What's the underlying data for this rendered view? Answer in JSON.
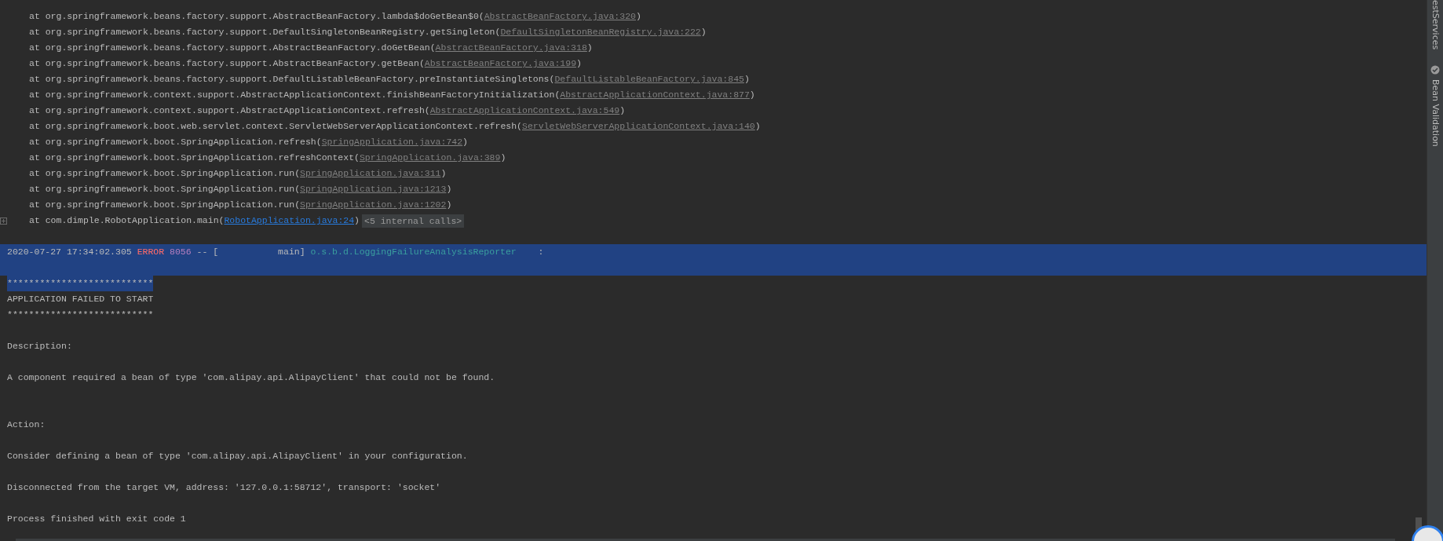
{
  "console": {
    "lines": [
      {
        "kind": "frame",
        "text": "at org.springframework.beans.factory.support.AbstractBeanFactory.lambda$doGetBean$0(",
        "link": "AbstractBeanFactory.java:320",
        "tail": ")",
        "selected": false
      },
      {
        "kind": "frame",
        "text": "at org.springframework.beans.factory.support.DefaultSingletonBeanRegistry.getSingleton(",
        "link": "DefaultSingletonBeanRegistry.java:222",
        "tail": ")",
        "selected": false
      },
      {
        "kind": "frame",
        "text": "at org.springframework.beans.factory.support.AbstractBeanFactory.doGetBean(",
        "link": "AbstractBeanFactory.java:318",
        "tail": ")",
        "selected": false
      },
      {
        "kind": "frame",
        "text": "at org.springframework.beans.factory.support.AbstractBeanFactory.getBean(",
        "link": "AbstractBeanFactory.java:199",
        "tail": ")",
        "selected": false
      },
      {
        "kind": "frame",
        "text": "at org.springframework.beans.factory.support.DefaultListableBeanFactory.preInstantiateSingletons(",
        "link": "DefaultListableBeanFactory.java:845",
        "tail": ")",
        "selected": false
      },
      {
        "kind": "frame",
        "text": "at org.springframework.context.support.AbstractApplicationContext.finishBeanFactoryInitialization(",
        "link": "AbstractApplicationContext.java:877",
        "tail": ")",
        "selected": false
      },
      {
        "kind": "frame",
        "text": "at org.springframework.context.support.AbstractApplicationContext.refresh(",
        "link": "AbstractApplicationContext.java:549",
        "tail": ")",
        "selected": false
      },
      {
        "kind": "frame",
        "text": "at org.springframework.boot.web.servlet.context.ServletWebServerApplicationContext.refresh(",
        "link": "ServletWebServerApplicationContext.java:140",
        "tail": ")",
        "selected": false
      },
      {
        "kind": "frame",
        "text": "at org.springframework.boot.SpringApplication.refresh(",
        "link": "SpringApplication.java:742",
        "tail": ")",
        "selected": false
      },
      {
        "kind": "frame",
        "text": "at org.springframework.boot.SpringApplication.refreshContext(",
        "link": "SpringApplication.java:389",
        "tail": ")",
        "selected": false
      },
      {
        "kind": "frame",
        "text": "at org.springframework.boot.SpringApplication.run(",
        "link": "SpringApplication.java:311",
        "tail": ")",
        "selected": false
      },
      {
        "kind": "frame",
        "text": "at org.springframework.boot.SpringApplication.run(",
        "link": "SpringApplication.java:1213",
        "tail": ")",
        "selected": false
      },
      {
        "kind": "frame",
        "text": "at org.springframework.boot.SpringApplication.run(",
        "link": "SpringApplication.java:1202",
        "tail": ")",
        "selected": false
      },
      {
        "kind": "frame",
        "text": "at com.dimple.RobotApplication.main(",
        "link": "RobotApplication.java:24",
        "tail": ")",
        "internal": "<5 internal calls>",
        "foldable": true,
        "selected": false
      },
      {
        "kind": "blank",
        "selected": false
      },
      {
        "kind": "log",
        "timestamp": "2020-07-27 17:34:02.305",
        "level": "ERROR",
        "pid": "8056",
        "sep": "-- [",
        "thread": "           main]",
        "logger": "o.s.b.d.LoggingFailureAnalysisReporter",
        "colon": ":",
        "selected": true
      },
      {
        "kind": "blank",
        "selected": true
      },
      {
        "kind": "text",
        "text": "***************************",
        "selected": true
      },
      {
        "kind": "text",
        "text": "APPLICATION FAILED TO START",
        "selected": false
      },
      {
        "kind": "text",
        "text": "***************************",
        "selected": false
      },
      {
        "kind": "blank",
        "selected": false
      },
      {
        "kind": "text",
        "text": "Description:",
        "selected": false
      },
      {
        "kind": "blank",
        "selected": false
      },
      {
        "kind": "text",
        "text": "A component required a bean of type 'com.alipay.api.AlipayClient' that could not be found.",
        "selected": false
      },
      {
        "kind": "blank",
        "selected": false
      },
      {
        "kind": "blank",
        "selected": false
      },
      {
        "kind": "text",
        "text": "Action:",
        "selected": false
      },
      {
        "kind": "blank",
        "selected": false
      },
      {
        "kind": "text",
        "text": "Consider defining a bean of type 'com.alipay.api.AlipayClient' in your configuration.",
        "selected": false
      },
      {
        "kind": "blank",
        "selected": false
      },
      {
        "kind": "text",
        "text": "Disconnected from the target VM, address: '127.0.0.1:58712', transport: 'socket'",
        "selected": false
      },
      {
        "kind": "blank",
        "selected": false
      },
      {
        "kind": "text",
        "text": "Process finished with exit code 1",
        "selected": false
      }
    ]
  },
  "side_tabs": [
    {
      "label": "estServices",
      "icon": false
    },
    {
      "label": "Bean Validation",
      "icon": true
    }
  ]
}
